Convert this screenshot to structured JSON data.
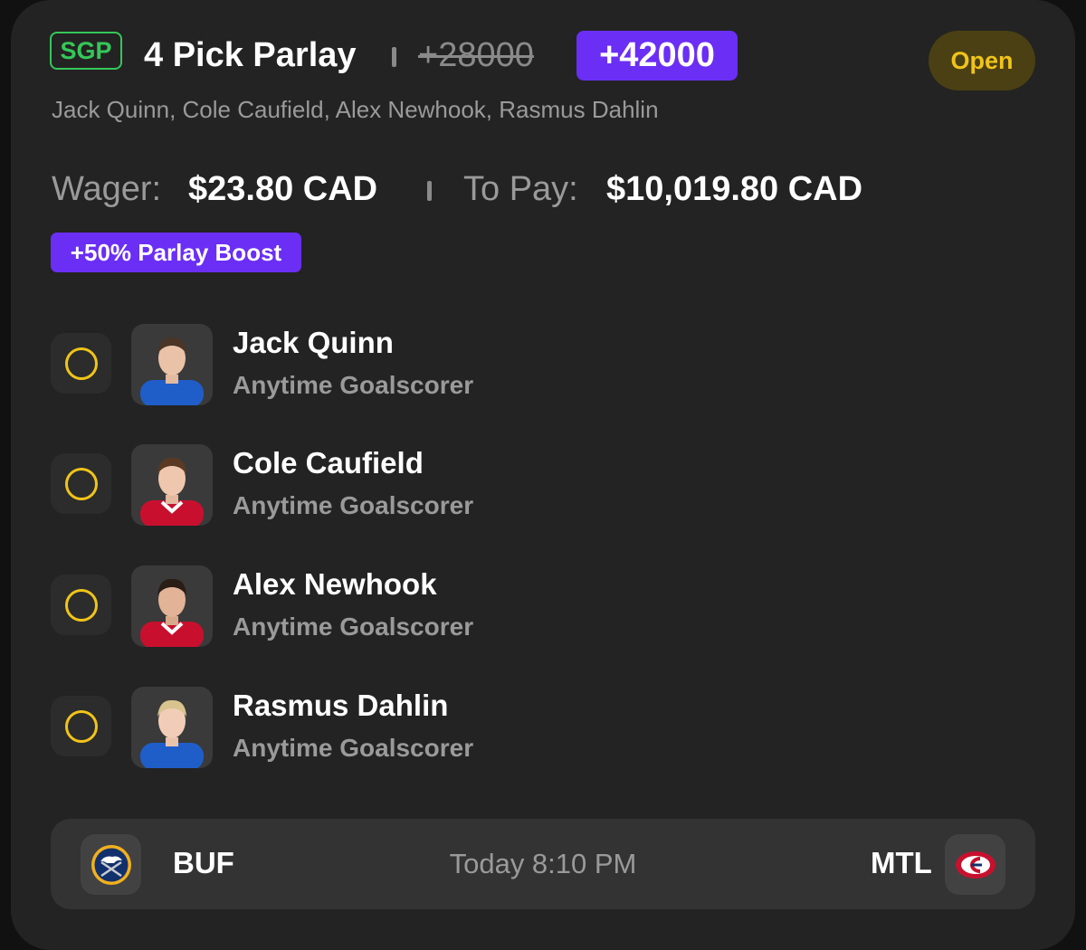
{
  "bet": {
    "badge": "SGP",
    "title": "4 Pick Parlay",
    "original_odds": "+28000",
    "boosted_odds": "+42000",
    "status": "Open",
    "selections_summary": "Jack Quinn, Cole Caufield, Alex Newhook, Rasmus Dahlin",
    "wager_label": "Wager:",
    "wager_amount": "$23.80 CAD",
    "payout_label": "To Pay:",
    "payout_amount": "$10,019.80 CAD",
    "boost_label": "+50% Parlay Boost"
  },
  "legs": [
    {
      "player": "Jack Quinn",
      "market": "Anytime Goalscorer",
      "jersey_color": "#1f5ec8",
      "jersey_trim": "#1f5ec8",
      "hair": "#4a3526"
    },
    {
      "player": "Cole Caufield",
      "market": "Anytime Goalscorer",
      "jersey_color": "#c8102e",
      "jersey_trim": "#ffffff",
      "hair": "#5a3a22"
    },
    {
      "player": "Alex Newhook",
      "market": "Anytime Goalscorer",
      "jersey_color": "#c8102e",
      "jersey_trim": "#ffffff",
      "hair": "#2a1d16"
    },
    {
      "player": "Rasmus Dahlin",
      "market": "Anytime Goalscorer",
      "jersey_color": "#1f5ec8",
      "jersey_trim": "#1f5ec8",
      "hair": "#d8c38e"
    }
  ],
  "game": {
    "away_team": "BUF",
    "home_team": "MTL",
    "time": "Today 8:10 PM",
    "away_logo_icon": "sabres-logo-icon",
    "home_logo_icon": "canadiens-logo-icon"
  },
  "colors": {
    "card_bg": "#232323",
    "accent_purple": "#6b2ef5",
    "sgp_green": "#35c759",
    "open_yellow": "#f0c419"
  }
}
